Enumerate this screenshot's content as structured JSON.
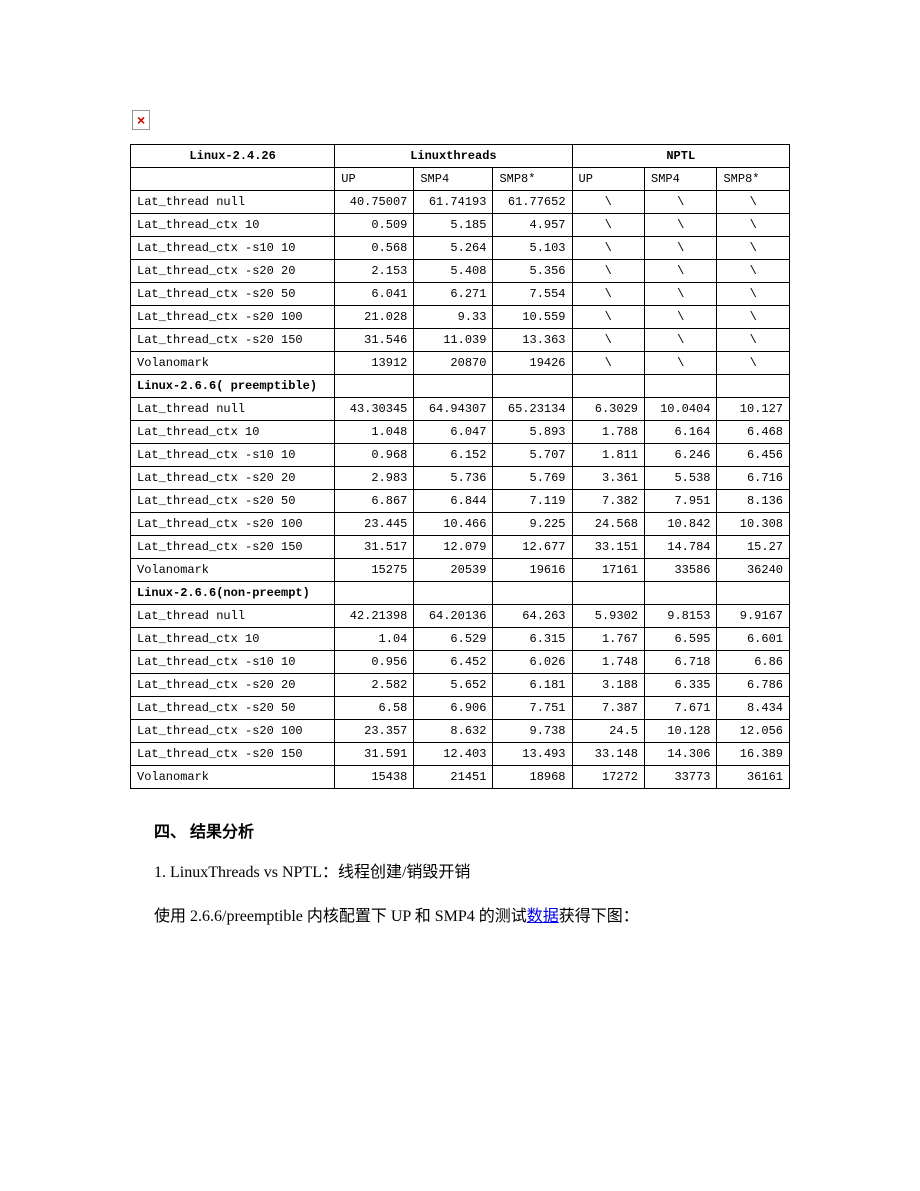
{
  "broken_image_alt": "×",
  "table": {
    "groups": [
      "Linuxthreads",
      "NPTL"
    ],
    "subheaders": [
      "UP",
      "SMP4",
      "SMP8*",
      "UP",
      "SMP4",
      "SMP8*"
    ],
    "sections": [
      {
        "title": "Linux-2.4.26",
        "rows": [
          {
            "label": "Lat_thread null",
            "v": [
              "40.75007",
              "61.74193",
              "61.77652",
              "\\",
              "\\",
              "\\"
            ],
            "c": [
              0,
              0,
              0,
              1,
              1,
              1
            ]
          },
          {
            "label": "Lat_thread_ctx 10",
            "v": [
              "0.509",
              "5.185",
              "4.957",
              "\\",
              "\\",
              "\\"
            ],
            "c": [
              0,
              0,
              0,
              1,
              1,
              1
            ]
          },
          {
            "label": "Lat_thread_ctx -s10 10",
            "v": [
              "0.568",
              "5.264",
              "5.103",
              "\\",
              "\\",
              "\\"
            ],
            "c": [
              0,
              0,
              0,
              1,
              1,
              1
            ]
          },
          {
            "label": "Lat_thread_ctx -s20 20",
            "v": [
              "2.153",
              "5.408",
              "5.356",
              "\\",
              "\\",
              "\\"
            ],
            "c": [
              0,
              0,
              0,
              1,
              1,
              1
            ]
          },
          {
            "label": "Lat_thread_ctx -s20 50",
            "v": [
              "6.041",
              "6.271",
              "7.554",
              "\\",
              "\\",
              "\\"
            ],
            "c": [
              0,
              0,
              0,
              1,
              1,
              1
            ]
          },
          {
            "label": "Lat_thread_ctx -s20 100",
            "v": [
              "21.028",
              "9.33",
              "10.559",
              "\\",
              "\\",
              "\\"
            ],
            "c": [
              0,
              0,
              0,
              1,
              1,
              1
            ]
          },
          {
            "label": "Lat_thread_ctx -s20 150",
            "v": [
              "31.546",
              "11.039",
              "13.363",
              "\\",
              "\\",
              "\\"
            ],
            "c": [
              0,
              0,
              0,
              1,
              1,
              1
            ]
          },
          {
            "label": "Volanomark",
            "v": [
              "13912",
              "20870",
              "19426",
              "\\",
              "\\",
              "\\"
            ],
            "c": [
              0,
              0,
              0,
              1,
              1,
              1
            ]
          }
        ]
      },
      {
        "title": "Linux-2.6.6( preemptible)",
        "rows": [
          {
            "label": "Lat_thread null",
            "v": [
              "43.30345",
              "64.94307",
              "65.23134",
              "6.3029",
              "10.0404",
              "10.127"
            ],
            "c": [
              0,
              0,
              0,
              0,
              0,
              0
            ]
          },
          {
            "label": "Lat_thread_ctx 10",
            "v": [
              "1.048",
              "6.047",
              "5.893",
              "1.788",
              "6.164",
              "6.468"
            ],
            "c": [
              0,
              0,
              0,
              0,
              0,
              0
            ]
          },
          {
            "label": "Lat_thread_ctx -s10 10",
            "v": [
              "0.968",
              "6.152",
              "5.707",
              "1.811",
              "6.246",
              "6.456"
            ],
            "c": [
              0,
              0,
              0,
              0,
              0,
              0
            ]
          },
          {
            "label": "Lat_thread_ctx -s20 20",
            "v": [
              "2.983",
              "5.736",
              "5.769",
              "3.361",
              "5.538",
              "6.716"
            ],
            "c": [
              0,
              0,
              0,
              0,
              0,
              0
            ]
          },
          {
            "label": "Lat_thread_ctx -s20 50",
            "v": [
              "6.867",
              "6.844",
              "7.119",
              "7.382",
              "7.951",
              "8.136"
            ],
            "c": [
              0,
              0,
              0,
              0,
              0,
              0
            ]
          },
          {
            "label": "Lat_thread_ctx -s20 100",
            "v": [
              "23.445",
              "10.466",
              "9.225",
              "24.568",
              "10.842",
              "10.308"
            ],
            "c": [
              0,
              0,
              0,
              0,
              0,
              0
            ]
          },
          {
            "label": "Lat_thread_ctx -s20 150",
            "v": [
              "31.517",
              "12.079",
              "12.677",
              "33.151",
              "14.784",
              "15.27"
            ],
            "c": [
              0,
              0,
              0,
              0,
              0,
              0
            ]
          },
          {
            "label": "Volanomark",
            "v": [
              "15275",
              "20539",
              "19616",
              "17161",
              "33586",
              "36240"
            ],
            "c": [
              0,
              0,
              0,
              0,
              0,
              0
            ]
          }
        ]
      },
      {
        "title": "Linux-2.6.6(non-preempt)",
        "rows": [
          {
            "label": "Lat_thread null",
            "v": [
              "42.21398",
              "64.20136",
              "64.263",
              "5.9302",
              "9.8153",
              "9.9167"
            ],
            "c": [
              0,
              0,
              0,
              0,
              0,
              0
            ]
          },
          {
            "label": "Lat_thread_ctx 10",
            "v": [
              "1.04",
              "6.529",
              "6.315",
              "1.767",
              "6.595",
              "6.601"
            ],
            "c": [
              0,
              0,
              0,
              0,
              0,
              0
            ]
          },
          {
            "label": "Lat_thread_ctx -s10 10",
            "v": [
              "0.956",
              "6.452",
              "6.026",
              "1.748",
              "6.718",
              "6.86"
            ],
            "c": [
              0,
              0,
              0,
              0,
              0,
              0
            ]
          },
          {
            "label": "Lat_thread_ctx -s20 20",
            "v": [
              "2.582",
              "5.652",
              "6.181",
              "3.188",
              "6.335",
              "6.786"
            ],
            "c": [
              0,
              0,
              0,
              0,
              0,
              0
            ]
          },
          {
            "label": "Lat_thread_ctx -s20 50",
            "v": [
              "6.58",
              "6.906",
              "7.751",
              "7.387",
              "7.671",
              "8.434"
            ],
            "c": [
              0,
              0,
              0,
              0,
              0,
              0
            ]
          },
          {
            "label": "Lat_thread_ctx -s20 100",
            "v": [
              "23.357",
              "8.632",
              "9.738",
              "24.5",
              "10.128",
              "12.056"
            ],
            "c": [
              0,
              0,
              0,
              0,
              0,
              0
            ]
          },
          {
            "label": "Lat_thread_ctx -s20 150",
            "v": [
              "31.591",
              "12.403",
              "13.493",
              "33.148",
              "14.306",
              "16.389"
            ],
            "c": [
              0,
              0,
              0,
              0,
              0,
              0
            ]
          },
          {
            "label": "Volanomark",
            "v": [
              "15438",
              "21451",
              "18968",
              "17272",
              "33773",
              "36161"
            ],
            "c": [
              0,
              0,
              0,
              0,
              0,
              0
            ]
          }
        ]
      }
    ]
  },
  "body": {
    "heading": "四、 结果分析",
    "p1": "1. LinuxThreads vs NPTL：线程创建/销毁开销",
    "p2_prefix": "使用 2.6.6/preemptible 内核配置下 UP 和 SMP4 的测试",
    "p2_link": "数据",
    "p2_suffix": "获得下图："
  }
}
